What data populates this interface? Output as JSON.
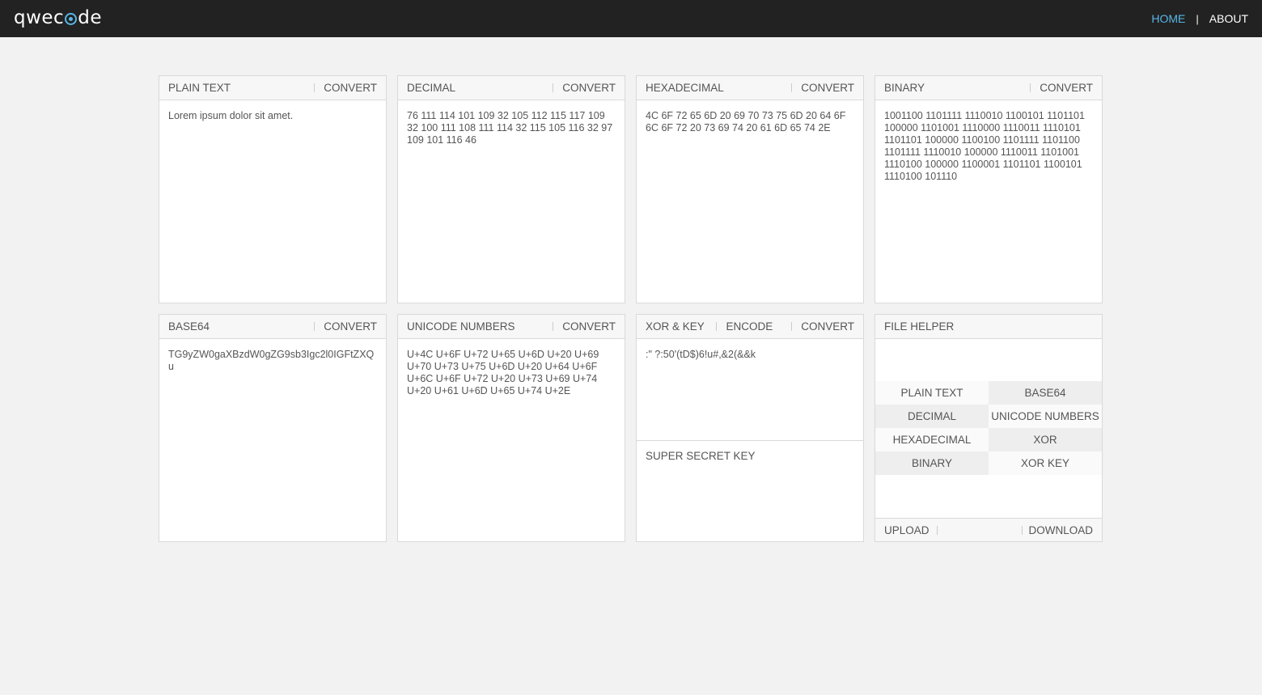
{
  "header": {
    "logo": "qwecode",
    "logo_parts": [
      "qwec",
      "de"
    ],
    "nav": [
      {
        "label": "HOME",
        "active": true
      },
      {
        "label": "ABOUT",
        "active": false
      }
    ],
    "nav_separator": "|"
  },
  "colors": {
    "accent": "#58b6e6",
    "topbar": "#222222",
    "page_bg": "#f2f2f2",
    "panel_border": "#d9d9d9"
  },
  "panels": {
    "plain_text": {
      "title": "PLAIN TEXT",
      "convert": "CONVERT",
      "content": "Lorem ipsum dolor sit amet."
    },
    "decimal": {
      "title": "DECIMAL",
      "convert": "CONVERT",
      "content": "76 111 114 101 109 32 105 112 115 117 109 32 100 111 108 111 114 32 115 105 116 32 97 109 101 116 46"
    },
    "hexadecimal": {
      "title": "HEXADECIMAL",
      "convert": "CONVERT",
      "content": "4C 6F 72 65 6D 20 69 70 73 75 6D 20 64 6F 6C 6F 72 20 73 69 74 20 61 6D 65 74 2E"
    },
    "binary": {
      "title": "BINARY",
      "convert": "CONVERT",
      "content": "1001100 1101111 1110010 1100101 1101101 100000 1101001 1110000 1110011 1110101 1101101 100000 1100100 1101111 1101100 1101111 1110010 100000 1110011 1101001 1110100 100000 1100001 1101101 1100101 1110100 101110"
    },
    "base64": {
      "title": "BASE64",
      "convert": "CONVERT",
      "content": "TG9yZW0gaXBzdW0gZG9sb3Igc2l0IGFtZXQu"
    },
    "unicode": {
      "title": "UNICODE NUMBERS",
      "convert": "CONVERT",
      "content": "U+4C U+6F U+72 U+65 U+6D U+20 U+69 U+70 U+73 U+75 U+6D U+20 U+64 U+6F U+6C U+6F U+72 U+20 U+73 U+69 U+74 U+20 U+61 U+6D U+65 U+74 U+2E"
    },
    "xor": {
      "title": "XOR & KEY",
      "encode": "ENCODE",
      "convert": "CONVERT",
      "content": ":\" ?:50'(tD$)6!u#,&2(&&k",
      "key": "SUPER SECRET KEY"
    },
    "file_helper": {
      "title": "FILE HELPER",
      "options": [
        [
          "PLAIN TEXT",
          "BASE64"
        ],
        [
          "DECIMAL",
          "UNICODE NUMBERS"
        ],
        [
          "HEXADECIMAL",
          "XOR"
        ],
        [
          "BINARY",
          "XOR KEY"
        ]
      ],
      "upload": "UPLOAD",
      "download": "DOWNLOAD"
    }
  }
}
